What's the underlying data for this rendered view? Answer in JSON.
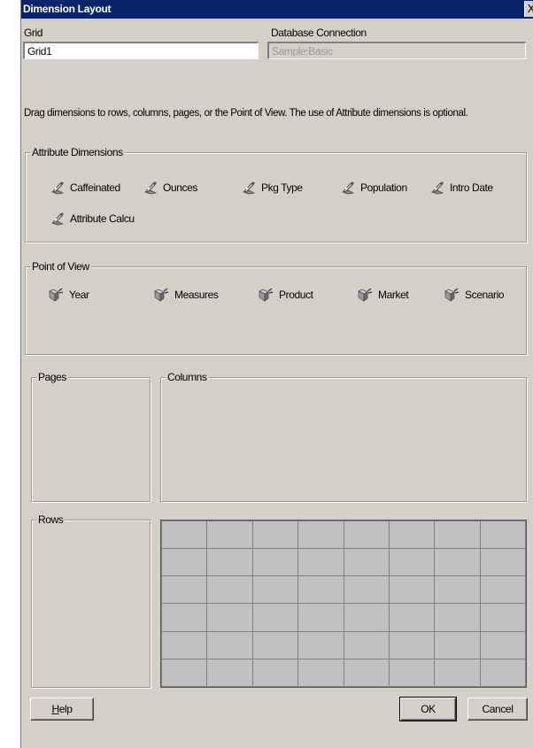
{
  "window": {
    "title": "Dimension Layout",
    "close_label": "X"
  },
  "grid_field": {
    "label": "Grid",
    "value": "Grid1"
  },
  "db_field": {
    "label": "Database Connection",
    "value": "Sample:Basic"
  },
  "instructions": "Drag dimensions to rows, columns, pages, or the Point of View. The use of Attribute dimensions is optional.",
  "attribute_dimensions": {
    "legend": "Attribute Dimensions",
    "items": [
      {
        "label": "Caffeinated",
        "icon": "attribute-dimension-icon"
      },
      {
        "label": "Ounces",
        "icon": "attribute-dimension-icon"
      },
      {
        "label": "Pkg Type",
        "icon": "attribute-dimension-icon"
      },
      {
        "label": "Population",
        "icon": "attribute-dimension-icon"
      },
      {
        "label": "Intro Date",
        "icon": "attribute-dimension-icon"
      },
      {
        "label": "Attribute Calcu",
        "icon": "attribute-dimension-icon"
      }
    ]
  },
  "point_of_view": {
    "legend": "Point of View",
    "items": [
      {
        "label": "Year",
        "icon": "dimension-icon"
      },
      {
        "label": "Measures",
        "icon": "dimension-icon"
      },
      {
        "label": "Product",
        "icon": "dimension-icon"
      },
      {
        "label": "Market",
        "icon": "dimension-icon"
      },
      {
        "label": "Scenario",
        "icon": "dimension-icon"
      }
    ]
  },
  "pages": {
    "legend": "Pages"
  },
  "columns": {
    "legend": "Columns"
  },
  "rows": {
    "legend": "Rows"
  },
  "buttons": {
    "help": "Help",
    "help_mnemonic": "H",
    "help_rest": "elp",
    "ok": "OK",
    "cancel": "Cancel"
  },
  "colors": {
    "title_bar": "#0a246a",
    "dialog_bg": "#d4d0c8",
    "grid_cell": "#c0c0c0"
  }
}
